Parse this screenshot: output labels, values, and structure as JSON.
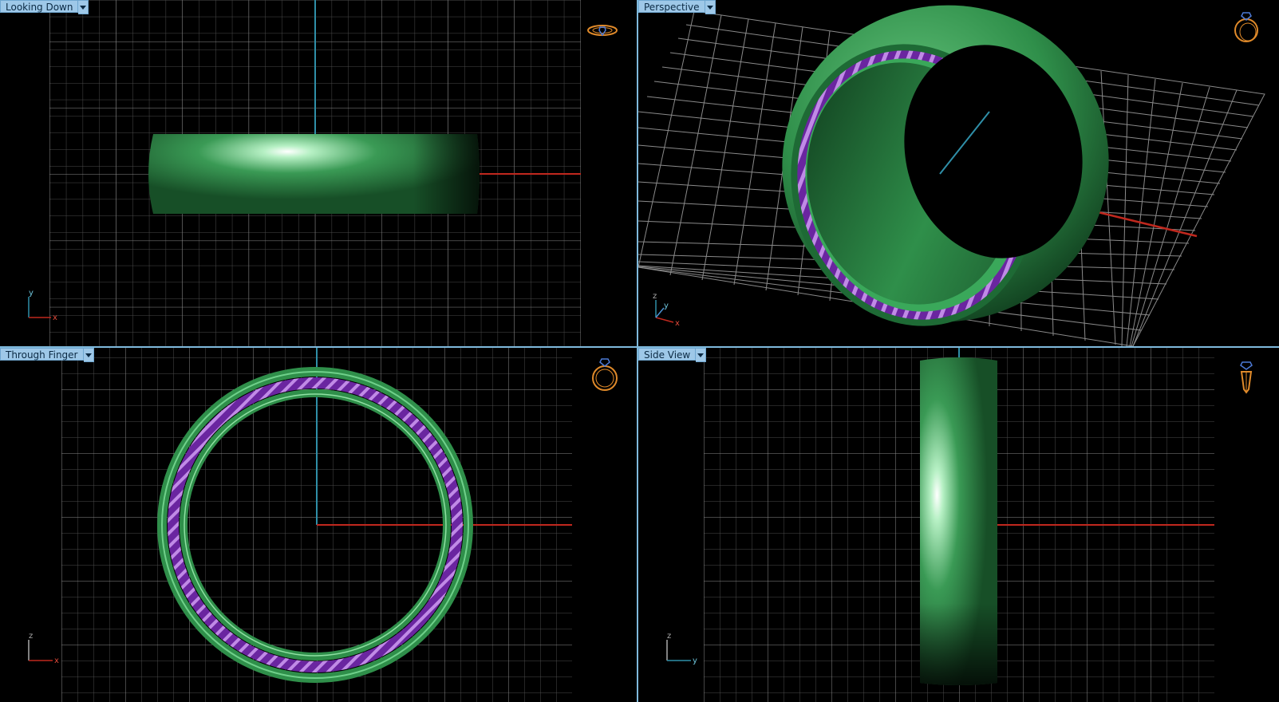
{
  "viewports": {
    "top": {
      "title": "Looking Down",
      "axis_v": "y",
      "axis_h": "x"
    },
    "perspective": {
      "title": "Perspective",
      "axis_v": "z",
      "axis_h": "y",
      "axis_d": "x"
    },
    "front": {
      "title": "Through Finger",
      "axis_v": "z",
      "axis_h": "x"
    },
    "side": {
      "title": "Side View",
      "axis_v": "z",
      "axis_h": "y"
    }
  },
  "icons": {
    "top": "ring-top-view-icon",
    "perspective": "ring-perspective-icon",
    "front": "ring-front-view-icon",
    "side": "ring-side-view-icon"
  },
  "colors": {
    "background": "#000000",
    "grid": "#5a5a5a",
    "axis_red": "#c0281e",
    "axis_cyan": "#2f8fa8",
    "ring_green": "#2f8f4a",
    "rope_purple": "#7a2fb0",
    "icon_orange": "#e08a2a",
    "header_bg": "#9ec8e8"
  }
}
